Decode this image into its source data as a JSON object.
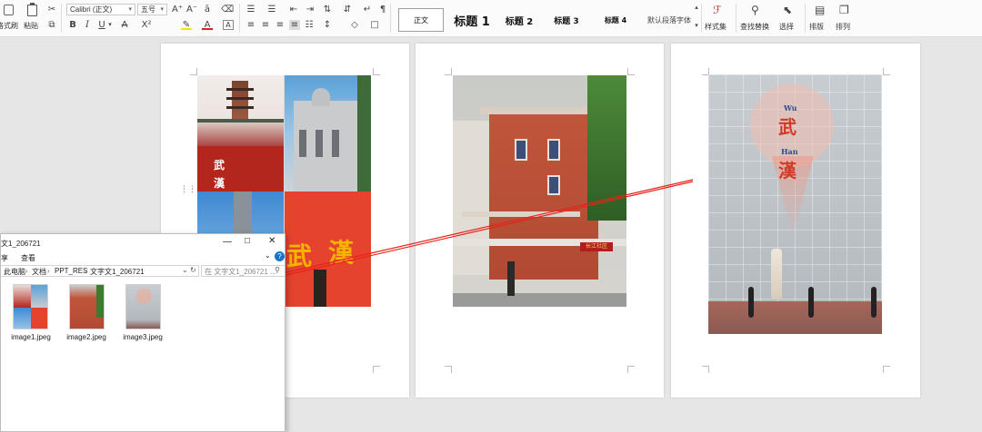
{
  "ribbon": {
    "format_painter_label": "格式刷",
    "paste_label": "粘贴",
    "font_name": "Calibri (正文)",
    "font_size": "五号",
    "bold": "B",
    "italic": "I",
    "underline": "U",
    "strike": "A",
    "superscript": "X²",
    "font_color_glyph": "A",
    "char_border_glyph": "A",
    "grow_font_glyph": "A⁺",
    "shrink_font_glyph": "A⁻",
    "styles": [
      {
        "label": "正文"
      },
      {
        "label": "标题 1"
      },
      {
        "label": "标题 2"
      },
      {
        "label": "标题 3"
      },
      {
        "label": "标题 4"
      },
      {
        "label": "默认段落字体"
      }
    ],
    "style_set_label": "样式集",
    "find_replace_label": "查找替换",
    "select_label": "选择",
    "layout_label": "排版",
    "arrange_label": "排列"
  },
  "explorer": {
    "title": "文1_206721",
    "menu_share": "享",
    "menu_view": "查看",
    "breadcrumb": [
      "此电脑",
      "文档",
      "PPT_RES",
      "文字文1_206721"
    ],
    "search_placeholder": "在 文字文1_206721 ...",
    "help_glyph": "?",
    "files": [
      {
        "name": "image1.jpeg"
      },
      {
        "name": "image2.jpeg"
      },
      {
        "name": "image3.jpeg"
      }
    ]
  },
  "poster3": {
    "line1": "Wu",
    "char1": "武",
    "line2": "Han",
    "char2": "漢"
  },
  "image1": {
    "char_a": "武",
    "char_b": "漢",
    "big_a": "武",
    "big_b": "漢"
  },
  "image2": {
    "sign_text": "长江社区"
  },
  "colors": {
    "arrow": "#e8221a",
    "ribbon_bg": "#fbfbfb",
    "workspace_bg": "#e6e6e6",
    "accent_blue": "#1a73c8"
  }
}
